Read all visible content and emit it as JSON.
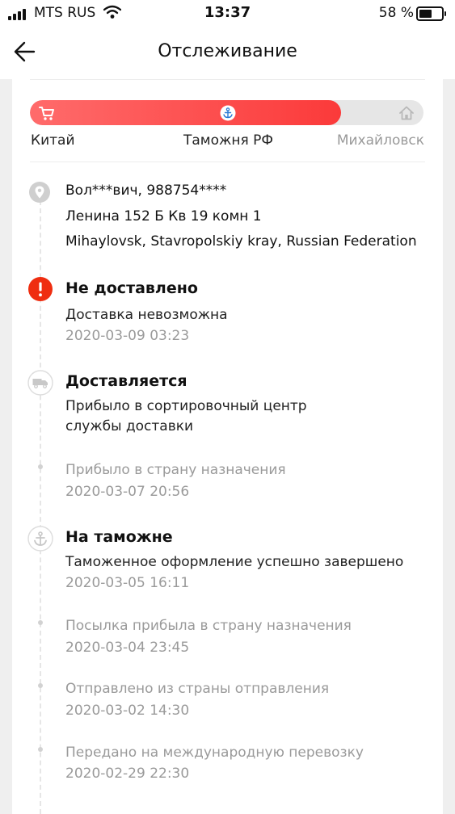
{
  "status_bar": {
    "carrier": "MTS RUS",
    "time": "13:37",
    "battery": "58 %",
    "battery_level": 0.58
  },
  "header": {
    "title": "Отслеживание"
  },
  "progress": {
    "fill_fraction": 0.79,
    "stages": [
      "Китай",
      "Таможня РФ",
      "Михайловск"
    ],
    "accent_color": "#fb3a3a"
  },
  "address": {
    "name_phone": "Вол***вич, 988754****",
    "street": "Ленина 152 Б Кв 19 комн 1",
    "city": "Mihaylovsk, Stavropolskiy kray, Russian Federation"
  },
  "events": [
    {
      "title": "Не доставлено",
      "text": "Доставка невозможна",
      "date": "2020-03-09 03:23",
      "icon": "alert-icon"
    },
    {
      "title": "Доставляется",
      "text_line1": "Прибыло в сортировочный центр",
      "text_line2": "службы доставки",
      "icon": "truck-icon"
    },
    {
      "text": "Прибыло в страну назначения",
      "date": "2020-03-07 20:56"
    },
    {
      "title": "На таможне",
      "text": "Таможенное оформление успешно завершено",
      "date": "2020-03-05 16:11",
      "icon": "anchor-icon"
    },
    {
      "text": "Посылка прибыла в страну назначения",
      "date": "2020-03-04 23:45"
    },
    {
      "text": "Отправлено из страны отправления",
      "date": "2020-03-02 14:30"
    },
    {
      "text": "Передано на международную перевозку",
      "date": "2020-02-29 22:30"
    }
  ]
}
